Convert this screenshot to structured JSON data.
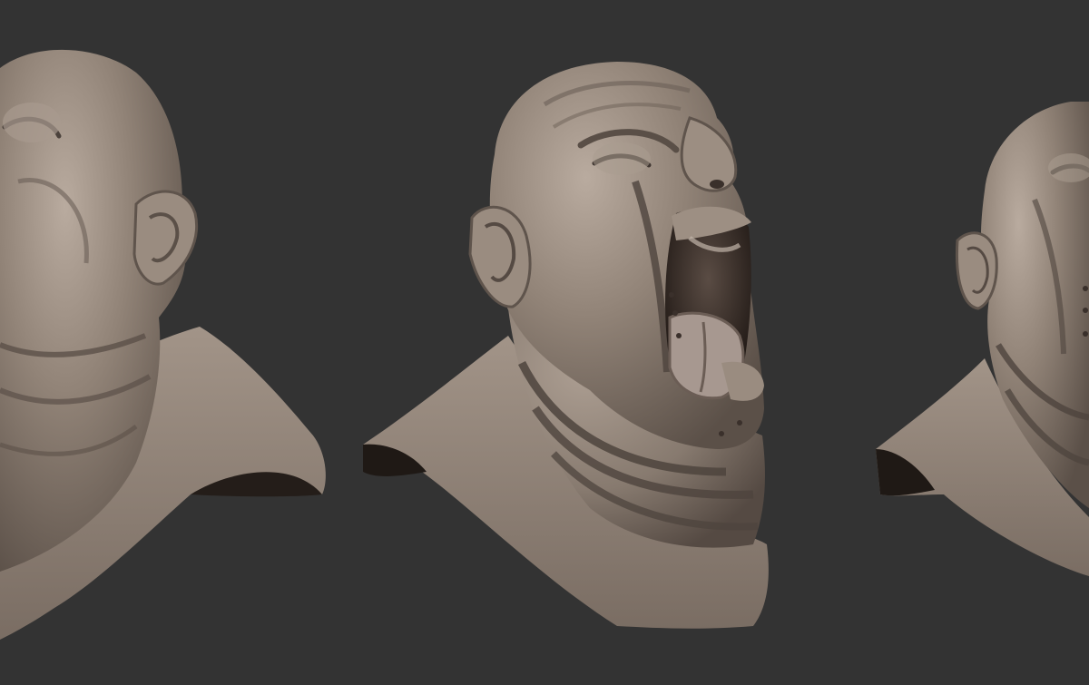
{
  "scene": {
    "background_color": "#333333",
    "clay_color": "#8f8177",
    "clay_light_color": "#b6a89c",
    "clay_shadow_color": "#4b423c",
    "mouth_color": "#3a2f2a",
    "tongue_color": "#a0918a",
    "views": [
      {
        "label": "left-cropped-view"
      },
      {
        "label": "center-three-quarter-view"
      },
      {
        "label": "right-cropped-view"
      }
    ]
  }
}
